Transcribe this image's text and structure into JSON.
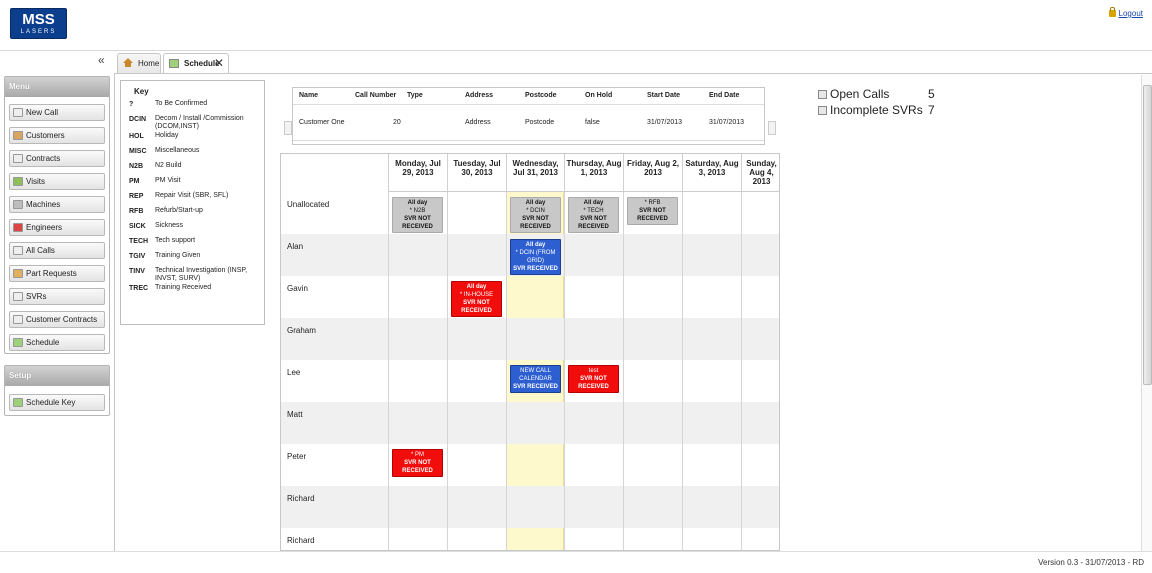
{
  "header": {
    "logo_line1": "MSS",
    "logo_line2": "LASERS",
    "logout": "Logout"
  },
  "tabs": [
    {
      "label": "Home"
    },
    {
      "label": "Schedule"
    }
  ],
  "menu": {
    "title": "Menu",
    "items": [
      {
        "label": "New Call"
      },
      {
        "label": "Customers"
      },
      {
        "label": "Contracts"
      },
      {
        "label": "Visits"
      },
      {
        "label": "Machines"
      },
      {
        "label": "Engineers"
      },
      {
        "label": "All Calls"
      },
      {
        "label": "Part Requests"
      },
      {
        "label": "SVRs"
      },
      {
        "label": "Customer Contracts"
      },
      {
        "label": "Schedule"
      }
    ]
  },
  "setup": {
    "title": "Setup",
    "items": [
      {
        "label": "Schedule Key"
      }
    ]
  },
  "key": {
    "title": "Key",
    "rows": [
      {
        "code": "?",
        "desc": "To Be Confirmed"
      },
      {
        "code": "DCIN",
        "desc": "Decom / Install /Commission (DCOM,INST)"
      },
      {
        "code": "HOL",
        "desc": "Holiday"
      },
      {
        "code": "MISC",
        "desc": "Miscellaneous"
      },
      {
        "code": "N2B",
        "desc": "N2 Build"
      },
      {
        "code": "PM",
        "desc": "PM Visit"
      },
      {
        "code": "REP",
        "desc": "Repair Visit (SBR, SFL)"
      },
      {
        "code": "RFB",
        "desc": "Refurb/Start-up"
      },
      {
        "code": "SICK",
        "desc": "Sickness"
      },
      {
        "code": "TECH",
        "desc": "Tech support"
      },
      {
        "code": "TGIV",
        "desc": "Training Given"
      },
      {
        "code": "TINV",
        "desc": "Technical Investigation (INSP, INVST, SURV)"
      },
      {
        "code": "TREC",
        "desc": "Training Received"
      }
    ]
  },
  "call": {
    "headers": [
      "Name",
      "Call Number",
      "Type",
      "Address",
      "Postcode",
      "On Hold",
      "Start Date",
      "End Date"
    ],
    "row": {
      "name": "Customer One",
      "call_number": "20",
      "address": "Address",
      "postcode": "Postcode",
      "on_hold": "false",
      "start": "31/07/2013",
      "end": "31/07/2013"
    }
  },
  "stats": {
    "open_calls_label": "Open Calls",
    "open_calls": "5",
    "incomplete_svrs_label": "Incomplete SVRs",
    "incomplete_svrs": "7"
  },
  "schedule": {
    "days": [
      "Monday, Jul 29, 2013",
      "Tuesday, Jul 30, 2013",
      "Wednesday, Jul 31, 2013",
      "Thursday, Aug 1, 2013",
      "Friday, Aug 2, 2013",
      "Saturday, Aug 3, 2013",
      "Sunday, Aug 4, 2013"
    ],
    "rows": [
      "Unallocated",
      "Alan",
      "Gavin",
      "Graham",
      "Lee",
      "Matt",
      "Peter",
      "Richard",
      "Richard"
    ],
    "events": {
      "u_mon": {
        "l1": "All day",
        "l2": "* N2B",
        "l3": "SVR NOT RECEIVED"
      },
      "u_wed": {
        "l1": "All day",
        "l2": "* DCIN",
        "l3": "SVR NOT RECEIVED"
      },
      "u_thu": {
        "l1": "All day",
        "l2": "* TECH",
        "l3": "SVR NOT RECEIVED"
      },
      "u_fri": {
        "l2": "* RFB",
        "l3": "SVR NOT RECEIVED"
      },
      "alan_wed": {
        "l1": "All day",
        "l2": "* DCIN (FROM GRID)",
        "l3": "SVR RECEIVED"
      },
      "gavin_tue": {
        "l1": "All day",
        "l2": "* IN-HOUSE",
        "l3": "SVR NOT RECEIVED"
      },
      "lee_wed": {
        "l1": "NEW CALL CALENDAR",
        "l3": "SVR RECEIVED"
      },
      "lee_thu": {
        "l1": "test",
        "l3": "SVR NOT RECEIVED"
      },
      "peter_mon": {
        "l2": "* PM",
        "l3": "SVR NOT RECEIVED"
      }
    }
  },
  "footer": {
    "version": "Version 0.3 - 31/07/2013 - RD"
  }
}
